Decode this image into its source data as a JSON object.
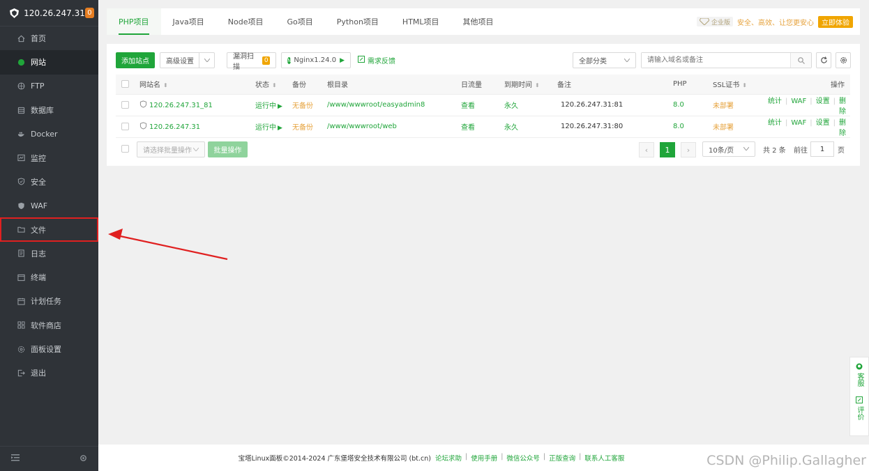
{
  "sidebar": {
    "server_ip": "120.26.247.31",
    "badge": "0",
    "items": [
      {
        "label": "首页",
        "icon": "home-icon"
      },
      {
        "label": "网站",
        "icon": "globe-icon"
      },
      {
        "label": "FTP",
        "icon": "ftp-icon"
      },
      {
        "label": "数据库",
        "icon": "database-icon"
      },
      {
        "label": "Docker",
        "icon": "docker-icon"
      },
      {
        "label": "监控",
        "icon": "monitor-icon"
      },
      {
        "label": "安全",
        "icon": "shield-icon"
      },
      {
        "label": "WAF",
        "icon": "waf-icon"
      },
      {
        "label": "文件",
        "icon": "folder-icon"
      },
      {
        "label": "日志",
        "icon": "log-icon"
      },
      {
        "label": "终端",
        "icon": "terminal-icon"
      },
      {
        "label": "计划任务",
        "icon": "calendar-icon"
      },
      {
        "label": "软件商店",
        "icon": "apps-icon"
      },
      {
        "label": "面板设置",
        "icon": "gear-icon"
      },
      {
        "label": "退出",
        "icon": "logout-icon"
      }
    ],
    "active_index": 1,
    "highlight_index": 8
  },
  "tabs": [
    {
      "label": "PHP项目"
    },
    {
      "label": "Java项目"
    },
    {
      "label": "Node项目"
    },
    {
      "label": "Go项目"
    },
    {
      "label": "Python项目"
    },
    {
      "label": "HTML项目"
    },
    {
      "label": "其他项目"
    }
  ],
  "promo": {
    "enterprise": "企业版",
    "slogan": "安全、高效、让您更安心",
    "try_label": "立即体验"
  },
  "toolbar": {
    "add_site": "添加站点",
    "advanced": "高级设置",
    "vuln_scan": "漏洞扫描",
    "vuln_count": "0",
    "nginx": "Nginx1.24.0",
    "feedback": "需求反馈",
    "category": "全部分类",
    "search_placeholder": "请输入域名或备注"
  },
  "table": {
    "headers": {
      "name": "网站名",
      "status": "状态",
      "backup": "备份",
      "root": "根目录",
      "traffic": "日流量",
      "expire": "到期时间",
      "note": "备注",
      "php": "PHP",
      "ssl": "SSL证书",
      "ops": "操作"
    },
    "rows": [
      {
        "name": "120.26.247.31_81",
        "status": "运行中",
        "backup": "无备份",
        "root": "/www/wwwroot/easyadmin8",
        "traffic": "查看",
        "expire": "永久",
        "note": "120.26.247.31:81",
        "php": "8.0",
        "ssl": "未部署",
        "op1": "统计",
        "op2": "WAF",
        "op3": "设置",
        "op4": "删除"
      },
      {
        "name": "120.26.247.31",
        "status": "运行中",
        "backup": "无备份",
        "root": "/www/wwwroot/web",
        "traffic": "查看",
        "expire": "永久",
        "note": "120.26.247.31:80",
        "php": "8.0",
        "ssl": "未部署",
        "op1": "统计",
        "op2": "WAF",
        "op3": "设置",
        "op4": "删除"
      }
    ]
  },
  "bottom": {
    "batch_placeholder": "请选择批量操作",
    "batch_btn": "批量操作",
    "page_current": "1",
    "page_size": "10条/页",
    "total": "共 2 条",
    "goto_label": "前往",
    "goto_value": "1",
    "page_unit": "页"
  },
  "float": {
    "service": "客服",
    "review": "评价"
  },
  "footer": {
    "copyright": "宝塔Linux面板©2014-2024 广东堡塔安全技术有限公司 (bt.cn)",
    "links": [
      "论坛求助",
      "使用手册",
      "微信公众号",
      "正版查询",
      "联系人工客服"
    ]
  },
  "watermark": "CSDN @Philip.Gallagher",
  "colors": {
    "accent": "#20a53a",
    "sidebar_bg": "#2f3338",
    "warning": "#e6a23c",
    "annotation_red": "#e02020"
  }
}
